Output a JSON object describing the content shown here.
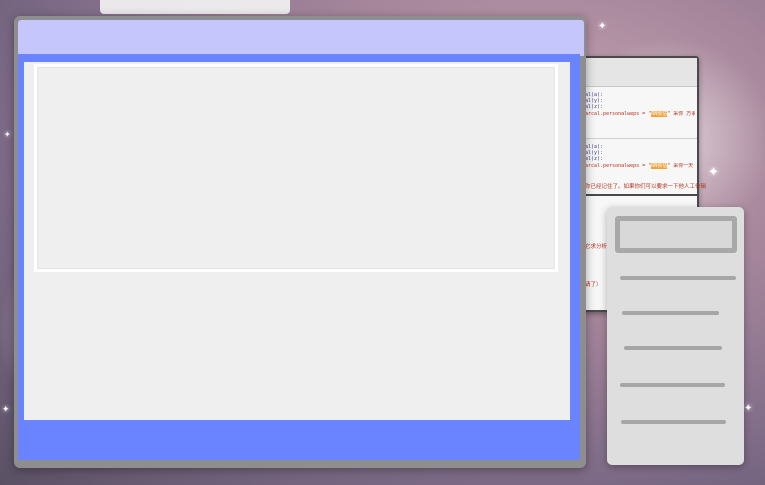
{
  "background": {
    "accent_colors": [
      "#c9a7b6",
      "#7c6a86",
      "#ffffff"
    ]
  },
  "back_window": {
    "code_block_1": [
      "al(a):",
      "al(y):",
      "al(z):",
      "arcal.personalweps = \"RN预估\" 采你 万事"
    ],
    "code_block_2": [
      "al(a):",
      "al(y):",
      "al(z):",
      "arcal.personalweps = \"RN预估\" 采你一天"
    ],
    "note_1": "你已经记住了。如果你们可以要求一下他人工作辑",
    "note_2": "它求分析",
    "note_3": "请了）",
    "highlight_color": "#f2a23a"
  },
  "main_dialog": {
    "titlebar_color": "#c5c6fb",
    "frame_color": "#6a84ff",
    "body_color": "#efefef"
  },
  "side_panel": {
    "field_value": "",
    "items": [
      {
        "label": ""
      },
      {
        "label": ""
      },
      {
        "label": ""
      },
      {
        "label": ""
      },
      {
        "label": ""
      }
    ]
  }
}
